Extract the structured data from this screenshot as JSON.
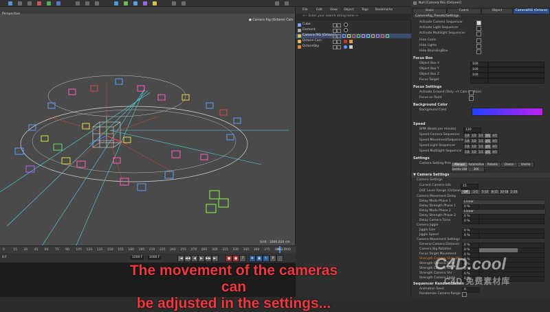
{
  "viewport": {
    "view_name": "Perspective",
    "camera_label": "● Camera Rig (Octane) Cam",
    "grid_spacing_label": "Grid : 1000.024 cm"
  },
  "timeline": {
    "ticks": [
      "0",
      "15",
      "30",
      "45",
      "60",
      "75",
      "90",
      "105",
      "120",
      "135",
      "150",
      "165",
      "180",
      "195",
      "210",
      "225",
      "240",
      "255",
      "270",
      "285",
      "300",
      "315",
      "330",
      "345",
      "360",
      "375",
      "390",
      "400"
    ],
    "frame_left": "0 F",
    "frame_field": "1000 F",
    "end_field": "1000 F",
    "current_frame": "402 F"
  },
  "object_manager": {
    "menu": [
      "File",
      "Edit",
      "View",
      "Object",
      "Tags",
      "Bookmarks"
    ],
    "search_placeholder": "<-- Enter your search string here-->",
    "objects": [
      {
        "name": "Cube",
        "icon_color": "#6fa8ff",
        "selected": false
      },
      {
        "name": "Element",
        "icon_color": "#aaaaaa",
        "selected": false
      },
      {
        "name": "Camera RIG (Octane)",
        "icon_color": "#d6c14a",
        "selected": true
      },
      {
        "name": "Octane Cam",
        "icon_color": "#d6c14a",
        "selected": false
      },
      {
        "name": "OctaneSky",
        "icon_color": "#e08a3a",
        "selected": false
      }
    ]
  },
  "attributes": {
    "header": "Null [Camera RIG (Octane)]",
    "tabs": [
      "Basic",
      "Coord.",
      "Object",
      "CameraRIG (Octane)"
    ],
    "subtab": "CameraRig_Presets/Settings",
    "toggles": [
      {
        "label": "Activate Camera Sequencer",
        "checked": true
      },
      {
        "label": "Activate Light Sequencer",
        "checked": false
      },
      {
        "label": "Activate Multilight Sequencer",
        "checked": false
      },
      {
        "label": "Hide Cams",
        "checked": false
      },
      {
        "label": "Hide Lights",
        "checked": false
      },
      {
        "label": "Hide BoundingBox",
        "checked": false
      }
    ],
    "focus_box": {
      "title": "Focus Box",
      "rows": [
        {
          "label": "Object Box X",
          "value": "100"
        },
        {
          "label": "Object Box Y",
          "value": "100"
        },
        {
          "label": "Object Box Z",
          "value": "100"
        },
        {
          "label": "Focus Target",
          "value": ""
        }
      ]
    },
    "focus_settings": {
      "title": "Focus Settings",
      "rows": [
        {
          "label": "Activate Ground (Only +Y Cam Position)"
        },
        {
          "label": "Focus on Point"
        }
      ]
    },
    "background_color": {
      "title": "Background Color",
      "label": "Background Color",
      "gradient_start": "#2040ff",
      "gradient_end": "#c020f0"
    },
    "speed": {
      "title": "Speed",
      "bpm_label": "BPM (Beats per minute)",
      "bpm_value": "120",
      "rows": [
        "Speed Camera Sequencer",
        "Speed Movement/Sequencer Effects",
        "Speed Light Sequencer",
        "Speed Multilight Sequencer"
      ],
      "options": [
        "1/4",
        "1/2",
        "1/1",
        "2/1",
        "4/1"
      ],
      "active_index": 3
    },
    "settings": {
      "title": "Settings",
      "presets_label": "Camera Setting Presets",
      "presets_row1": [
        "Manual",
        "Automotive",
        "Robotic",
        "Dance",
        "Vanilla"
      ],
      "presets_row2": [
        "Gentle 360",
        "360"
      ],
      "active_preset": "Manual"
    },
    "camera_settings": {
      "title": "▼ Camera Settings",
      "sub": "Camera Settings",
      "current_camera_label": "Current Camera Info",
      "current_camera_value": "15",
      "dof_label": "DOF Lever Range (Octane)",
      "dof_options": [
        "Off",
        "2-5",
        "5-10",
        "8-15",
        "10-18",
        "2-20"
      ],
      "movement_delay_title": "Camera Movement Delay",
      "delay_rows": [
        {
          "label": "Delay Mode Phase 1",
          "value": "Linear",
          "type": "dropdown"
        },
        {
          "label": "Delay Strength Phase 1",
          "value": "0 %",
          "type": "slider"
        },
        {
          "label": "Delay Mode Phase 2",
          "value": "Linear",
          "type": "dropdown"
        },
        {
          "label": "Delay Strength Phase 2",
          "value": "0 %",
          "type": "slider"
        },
        {
          "label": "Delay Camera Turns",
          "value": "0 %",
          "type": "slider"
        }
      ],
      "jiggle_title": "Camera Jiggle",
      "jiggle_rows": [
        {
          "label": "Jiggle Size",
          "value": "0 %"
        },
        {
          "label": "Jiggle Speed",
          "value": "0 %"
        }
      ],
      "movement_settings_title": "Camera Movement Settings",
      "movement_rows": [
        {
          "label": "General Camera Distance",
          "value": "0 %",
          "fill": 0.0,
          "highlight": false
        },
        {
          "label": "Camera Big Rotation",
          "value": "0 %",
          "fill": 0.6,
          "highlight": false
        },
        {
          "label": "Focus Target Movement",
          "value": "0 %",
          "fill": 0.0,
          "highlight": false
        },
        {
          "label": "Strength Camera Slide (0)",
          "value": "0 %",
          "fill": 0.0,
          "highlight": true
        },
        {
          "label": "Strength Camera Slide",
          "value": "0 %",
          "fill": 0.0,
          "highlight": false
        },
        {
          "label": "Strength Camera Size",
          "value": "0 %",
          "fill": 0.0,
          "highlight": false
        },
        {
          "label": "Strength Camera Shr",
          "value": "0 %",
          "fill": 0.0,
          "highlight": false
        },
        {
          "label": "Strength Camera Jiggle",
          "value": "0 %",
          "fill": 0.0,
          "highlight": false
        }
      ],
      "randomization_title": "Sequencer Randomization",
      "random_rows": [
        {
          "label": "Animation Seed",
          "value": "0"
        },
        {
          "label": "Randomize Camera Range",
          "value": ""
        }
      ]
    }
  },
  "caption": {
    "line1": "The movement of the cameras can",
    "line2": "be adjusted in the settings..."
  },
  "watermark": {
    "brand": "C4D.cool",
    "sub": "C4D 免费素材库"
  },
  "colors": {
    "accent": "#2a4f8c",
    "caption": "#f0383f",
    "highlight_label": "#f07a2a"
  }
}
